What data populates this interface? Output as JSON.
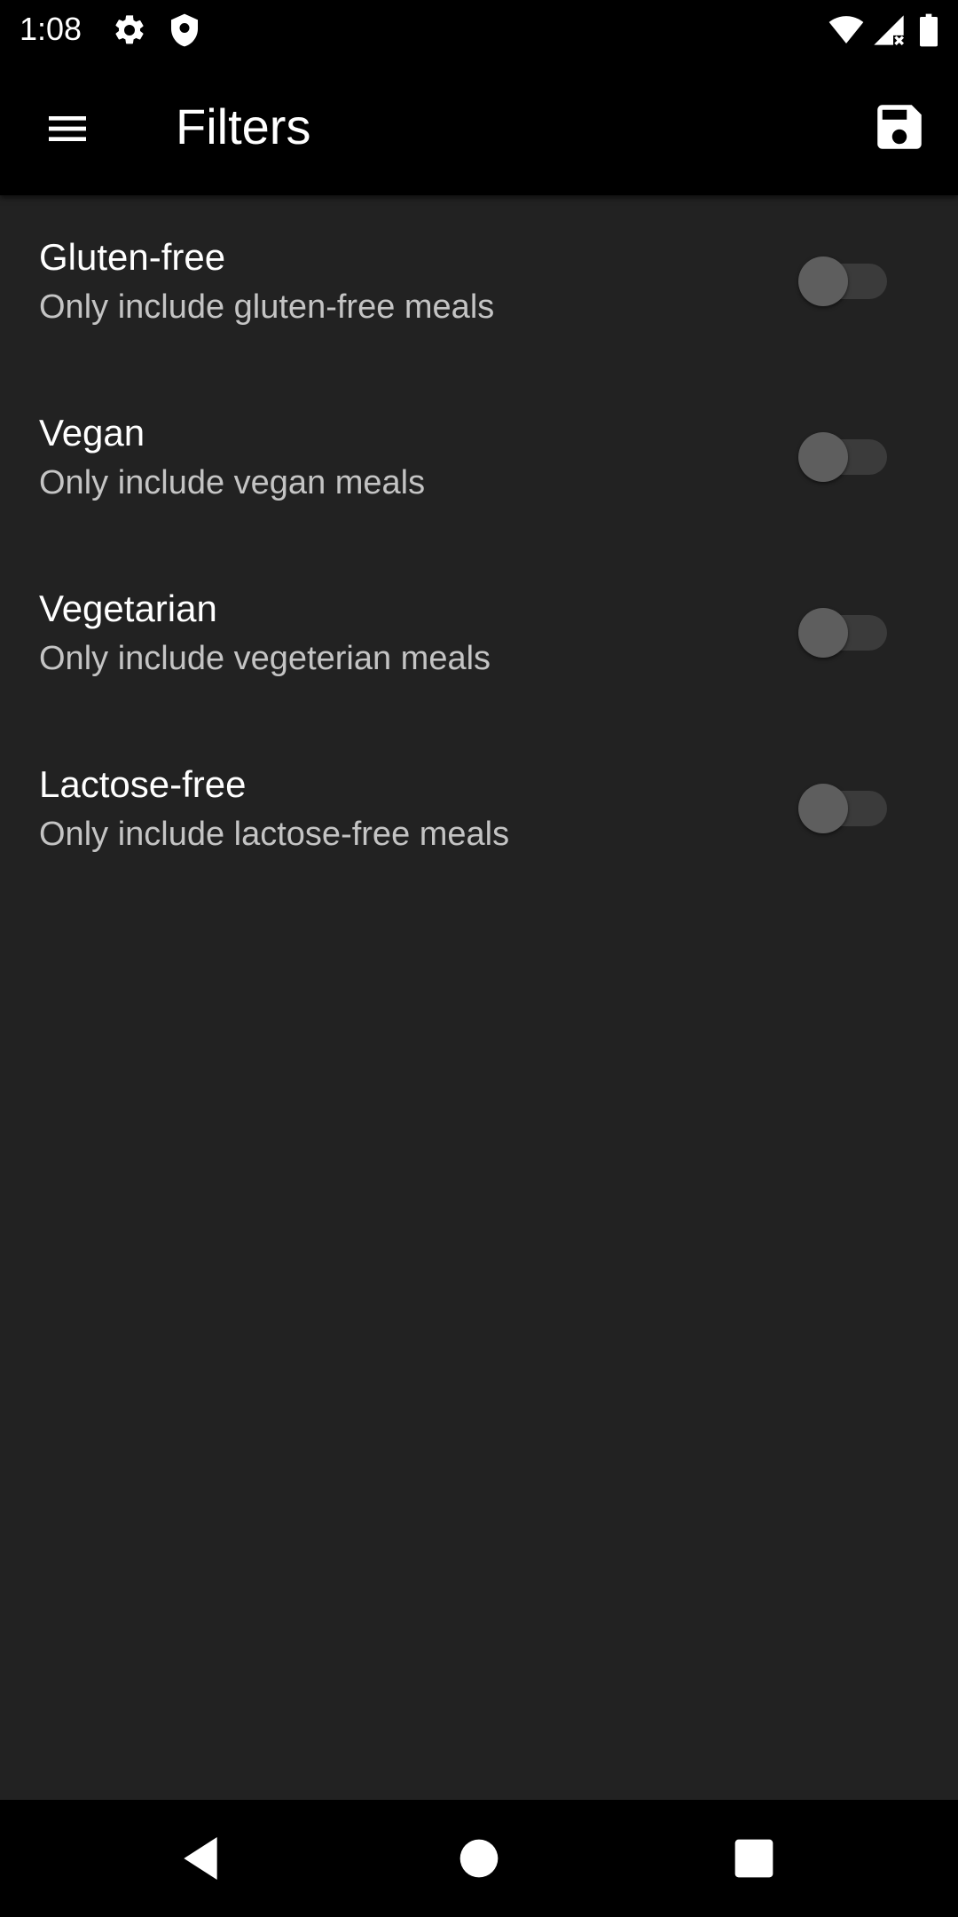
{
  "status_bar": {
    "time": "1:08",
    "left_icons": [
      "gear-icon",
      "shield-icon"
    ],
    "right_icons": [
      "wifi-icon",
      "cellular-no-signal-icon",
      "battery-icon"
    ]
  },
  "app_bar": {
    "title": "Filters",
    "menu_icon": "hamburger-menu-icon",
    "save_icon": "floppy-disk-save-icon"
  },
  "filters": [
    {
      "title": "Gluten-free",
      "subtitle": "Only include gluten-free meals",
      "enabled": false
    },
    {
      "title": "Vegan",
      "subtitle": "Only include vegan meals",
      "enabled": false
    },
    {
      "title": "Vegetarian",
      "subtitle": "Only include vegeterian meals",
      "enabled": false
    },
    {
      "title": "Lactose-free",
      "subtitle": "Only include lactose-free meals",
      "enabled": false
    }
  ],
  "nav_bar": {
    "icons": [
      "back-triangle-icon",
      "home-circle-icon",
      "recents-square-icon"
    ]
  },
  "colors": {
    "background": "#222222",
    "bars": "#000000",
    "title_text": "#ffffff",
    "subtitle_text": "#c4c4c4",
    "switch_track": "#3b3b3b",
    "switch_thumb": "#5e5e5e"
  }
}
